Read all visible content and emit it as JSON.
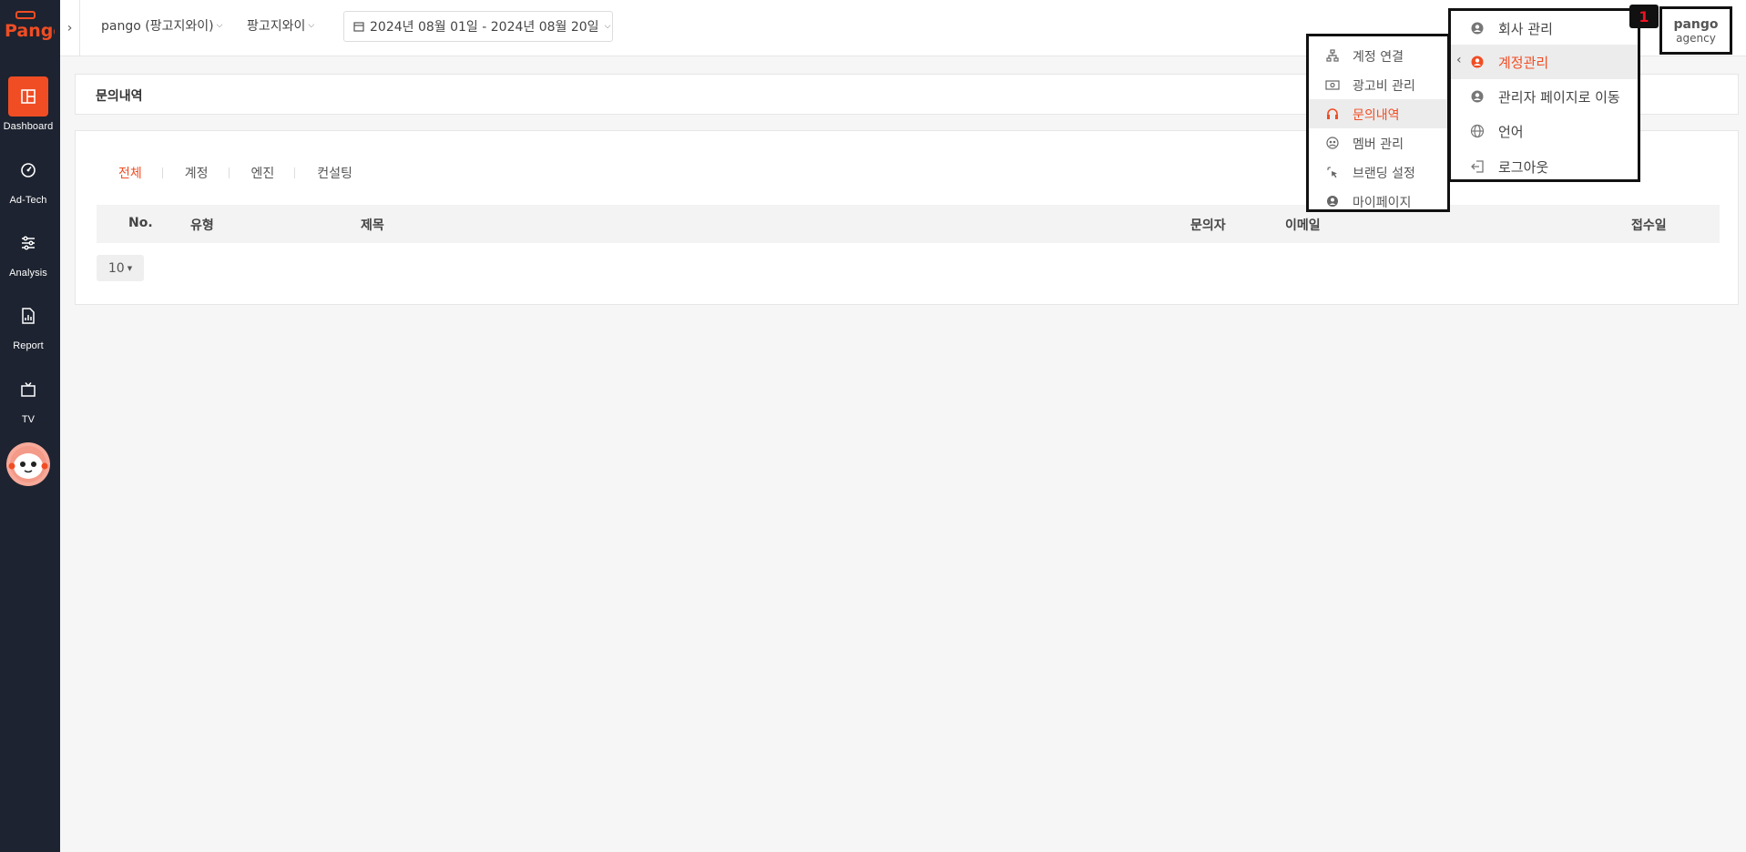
{
  "app": {
    "logo_text": "Pango",
    "accent": "#f04d24",
    "sidebar_bg": "#1d2330"
  },
  "sidebar": {
    "items": [
      {
        "label": "Dashboard",
        "icon": "dashboard-icon",
        "active": true
      },
      {
        "label": "Ad-Tech",
        "icon": "gauge-icon",
        "active": false
      },
      {
        "label": "Analysis",
        "icon": "sliders-icon",
        "active": false
      },
      {
        "label": "Report",
        "icon": "report-icon",
        "active": false
      },
      {
        "label": "TV",
        "icon": "tv-icon",
        "active": false
      }
    ],
    "mascot": "mascot-avatar"
  },
  "topbar": {
    "expand_icon": "chevron-right-icon",
    "company_select": "pango (팡고지와이)",
    "brand_select": "팡고지와이",
    "date_range": "2024년 08월 01일 - 2024년 08월 20일",
    "profile": {
      "name": "pango",
      "role": "agency"
    }
  },
  "page": {
    "title": "문의내역",
    "tabs": [
      "전체",
      "계정",
      "엔진",
      "컨설팅"
    ],
    "active_tab": "전체",
    "table": {
      "columns": [
        "No.",
        "유형",
        "제목",
        "문의자",
        "이메일",
        "접수일"
      ],
      "rows": []
    },
    "page_size": "10"
  },
  "menus": {
    "badge": "1",
    "main": [
      {
        "label": "회사 관리",
        "icon": "user-gear-icon",
        "active": false
      },
      {
        "label": "계정관리",
        "icon": "user-gear-icon",
        "active": true
      },
      {
        "label": "관리자 페이지로 이동",
        "icon": "user-gear-icon",
        "active": false
      },
      {
        "label": "언어",
        "icon": "globe-icon",
        "active": false
      },
      {
        "label": "로그아웃",
        "icon": "logout-icon",
        "active": false
      }
    ],
    "sub": [
      {
        "label": "계정 연결",
        "icon": "sitemap-icon",
        "active": false
      },
      {
        "label": "광고비 관리",
        "icon": "money-icon",
        "active": false
      },
      {
        "label": "문의내역",
        "icon": "headset-icon",
        "active": true
      },
      {
        "label": "멤버 관리",
        "icon": "members-icon",
        "active": false
      },
      {
        "label": "브랜딩 설정",
        "icon": "pointer-click-icon",
        "active": false
      },
      {
        "label": "마이페이지",
        "icon": "user-circle-icon",
        "active": false
      }
    ]
  }
}
